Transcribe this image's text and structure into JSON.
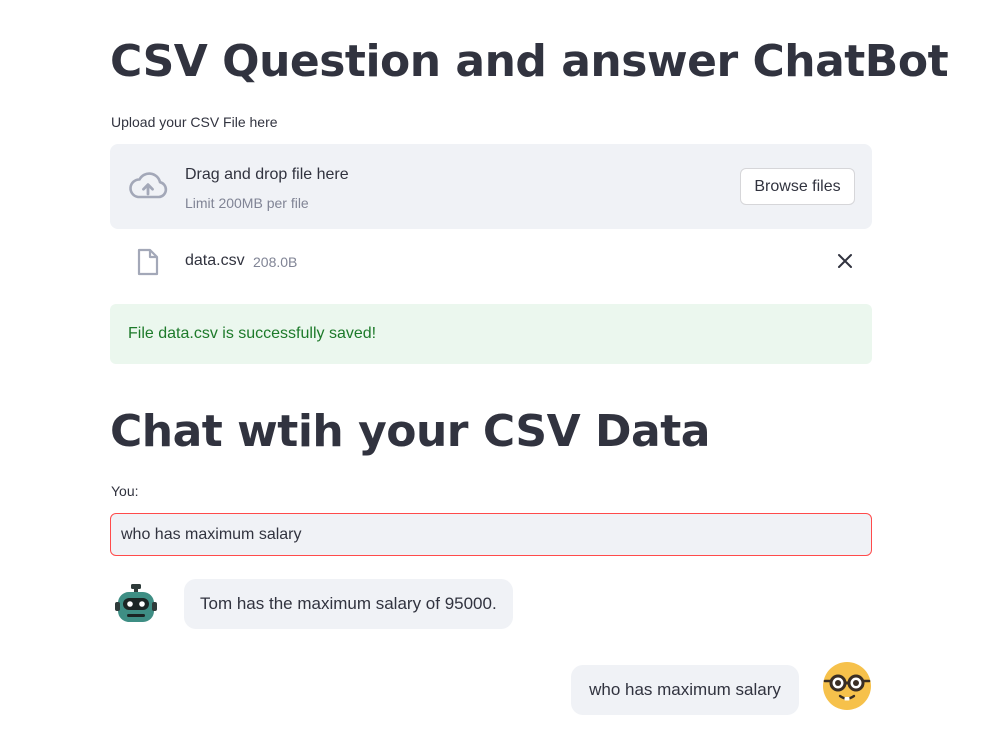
{
  "header": {
    "title": "CSV Question and answer ChatBot"
  },
  "uploader": {
    "label": "Upload your CSV File here",
    "dropzone_title": "Drag and drop file here",
    "dropzone_limit": "Limit 200MB per file",
    "browse_label": "Browse files",
    "icon": "cloud-upload-icon"
  },
  "uploaded_file": {
    "name": "data.csv",
    "size": "208.0B",
    "icon": "file-icon",
    "remove_icon": "close-icon"
  },
  "status": {
    "success_text": "File data.csv is successfully saved!"
  },
  "chat": {
    "heading": "Chat wtih your CSV Data",
    "input_label": "You:",
    "input_value": "who has maximum salary",
    "messages": [
      {
        "role": "bot",
        "text": "Tom has the maximum salary of 95000.",
        "avatar": "robot-avatar"
      },
      {
        "role": "user",
        "text": "who has maximum salary",
        "avatar": "nerd-face-avatar"
      }
    ]
  },
  "colors": {
    "text": "#31333f",
    "muted": "#808495",
    "panel": "#f0f2f6",
    "success_bg": "#ebf7ee",
    "success_text": "#1d7a2a",
    "focus_border": "#ff4b4b"
  }
}
